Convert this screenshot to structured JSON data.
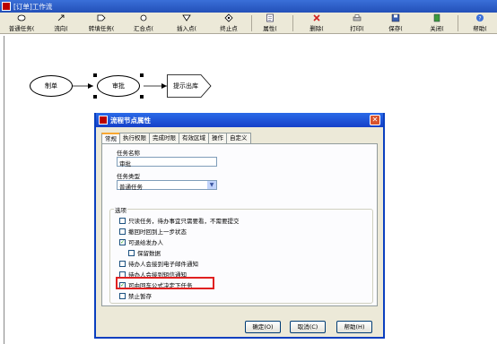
{
  "window": {
    "title": "[订单]工作流"
  },
  "toolbar": {
    "items": [
      {
        "label": "普通任务(",
        "icon": "ellipse-icon"
      },
      {
        "label": "流向(",
        "icon": "arrow-icon"
      },
      {
        "label": "转填任务(",
        "icon": "pentagon-icon"
      },
      {
        "label": "汇合点(",
        "icon": "circle-icon"
      },
      {
        "label": "插入点(",
        "icon": "triangle-icon"
      },
      {
        "label": "终止点",
        "icon": "diamond-icon"
      },
      {
        "label": "属性(",
        "icon": "properties-icon"
      },
      {
        "label": "删除(",
        "icon": "delete-icon"
      },
      {
        "label": "打印(",
        "icon": "print-icon"
      },
      {
        "label": "保存(",
        "icon": "save-icon"
      },
      {
        "label": "关闭(",
        "icon": "close-icon"
      },
      {
        "label": "帮助(",
        "icon": "help-icon"
      }
    ]
  },
  "flow": {
    "nodes": [
      "制单",
      "审批",
      "提示出库"
    ]
  },
  "dialog": {
    "title": "流程节点属性",
    "tabs": [
      "常规",
      "执行权限",
      "完成时限",
      "有效区域",
      "操作",
      "自定义"
    ],
    "task_name_label": "任务名称",
    "task_name_value": "审批",
    "task_type_label": "任务类型",
    "task_type_value": "普通任务",
    "options_label": "选项",
    "options": [
      {
        "label": "只读任务，待办事宜只需要看，不需要提交",
        "checked": false
      },
      {
        "label": "撤回时回到上一步状态",
        "checked": false
      },
      {
        "label": "可退给发办人",
        "checked": true
      },
      {
        "label": "保留数据",
        "checked": false
      },
      {
        "label": "待办人会接到电子邮件通知",
        "checked": false
      },
      {
        "label": "待办人会接到短信通知",
        "checked": false
      },
      {
        "label": "可由回车公式决定下任务",
        "checked": true
      },
      {
        "label": "禁止暂存",
        "checked": false
      }
    ],
    "buttons": {
      "ok": "确定(O)",
      "cancel": "取消(C)",
      "help": "帮助(H)"
    }
  },
  "colors": {
    "highlight": "#e02020",
    "titlebar": "#2350b8"
  }
}
